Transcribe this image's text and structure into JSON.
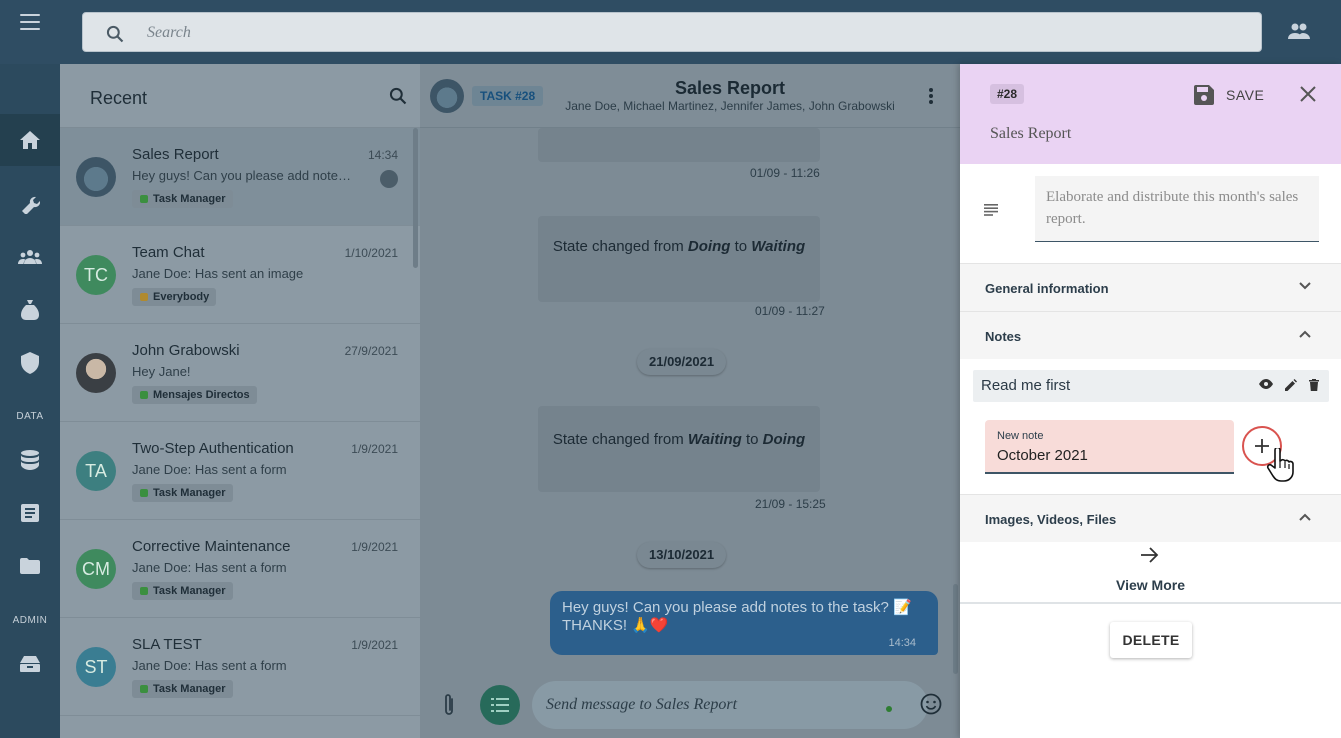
{
  "topbar": {
    "search_placeholder": "Search"
  },
  "sidebar": {
    "sections": {
      "data_label": "DATA",
      "admin_label": "ADMIN"
    },
    "items": [
      {
        "icon": "home-icon"
      },
      {
        "icon": "wrench-icon"
      },
      {
        "icon": "group-icon"
      },
      {
        "icon": "bag-icon"
      },
      {
        "icon": "shield-icon"
      },
      {
        "icon": "database-icon"
      },
      {
        "icon": "document-icon"
      },
      {
        "icon": "folder-icon"
      },
      {
        "icon": "admin-tray-icon"
      }
    ]
  },
  "recent": {
    "title": "Recent",
    "chats": [
      {
        "name": "Sales Report",
        "time": "14:34",
        "snippet": "Hey guys! Can you please add note…",
        "tag": "Task Manager",
        "initials": "",
        "color": "#5a6f7d"
      },
      {
        "name": "Team Chat",
        "time": "1/10/2021",
        "snippet": "Jane Doe: Has sent an image",
        "tag": "Everybody",
        "initials": "TC",
        "color": "#3f8a5e"
      },
      {
        "name": "John Grabowski",
        "time": "27/9/2021",
        "snippet": "Hey Jane!",
        "tag": "Mensajes Directos",
        "initials": "",
        "color": "#4a4f55"
      },
      {
        "name": "Two-Step Authentication",
        "time": "1/9/2021",
        "snippet": "Jane Doe: Has sent a form",
        "tag": "Task Manager",
        "initials": "TA",
        "color": "#3d7f80"
      },
      {
        "name": "Corrective Maintenance",
        "time": "1/9/2021",
        "snippet": "Jane Doe: Has sent a form",
        "tag": "Task Manager",
        "initials": "CM",
        "color": "#3f8a5e"
      },
      {
        "name": "SLA TEST",
        "time": "1/9/2021",
        "snippet": "Jane Doe: Has sent a form",
        "tag": "Task Manager",
        "initials": "ST",
        "color": "#3a7d92"
      }
    ]
  },
  "chat": {
    "task_badge": "TASK #28",
    "title": "Sales Report",
    "members": "Jane Doe, Michael Martinez, Jennifer James, John Grabowski",
    "messages": {
      "t1": "01/09 - 11:26",
      "m1_pre": "State changed from ",
      "m1_a": "Doing",
      "m1_mid": " to ",
      "m1_b": "Waiting",
      "t2": "01/09 - 11:27",
      "d1": "21/09/2021",
      "m2_pre": "State changed from ",
      "m2_a": "Waiting",
      "m2_mid": " to ",
      "m2_b": "Doing",
      "t3": "21/09 - 15:25",
      "d2": "13/10/2021",
      "mine": "Hey guys! Can you please add notes to the task? 📝 THANKS! 🙏❤️",
      "mine_time": "14:34"
    },
    "composer_placeholder": "Send message to Sales Report"
  },
  "task": {
    "id": "#28",
    "save_label": "SAVE",
    "name": "Sales Report",
    "description": "Elaborate and distribute this month's sales report.",
    "sections": {
      "general": "General information",
      "notes": "Notes",
      "media": "Images, Videos, Files"
    },
    "note_title": "Read me first",
    "new_note_label": "New note",
    "new_note_value": "October 2021",
    "view_more": "View More",
    "delete_label": "DELETE"
  },
  "colors": {
    "topbar": "#2f4d63",
    "sidebar": "#2c4a5e",
    "task_header": "#ead3f3",
    "new_note_bg": "#f8dcd9",
    "my_bubble": "#2c5f8c"
  }
}
